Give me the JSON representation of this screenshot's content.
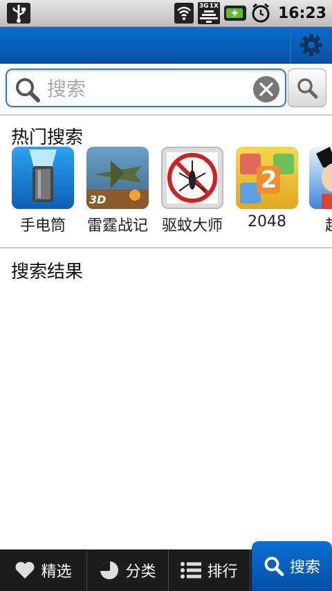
{
  "status_bar": {
    "time": "16:23",
    "net_labels": [
      "3G",
      "1X"
    ],
    "icons": [
      "usb-icon",
      "wifi-icon",
      "signal-icon",
      "battery-charging-icon",
      "alarm-icon"
    ]
  },
  "title_bar": {
    "settings_icon": "gear-icon"
  },
  "search": {
    "placeholder": "搜索",
    "value": ""
  },
  "hot_search": {
    "title": "热门搜索",
    "apps": [
      {
        "name": "手电筒",
        "icon": "flashlight-app-icon"
      },
      {
        "name": "雷霆战记",
        "icon": "fighter-plane-app-icon",
        "badge": "3D"
      },
      {
        "name": "驱蚊大师",
        "icon": "mosquito-app-icon"
      },
      {
        "name": "2048",
        "icon": "game-2048-app-icon",
        "badge": "2"
      },
      {
        "name": "超级",
        "icon": "cartoon-app-icon"
      }
    ]
  },
  "results": {
    "title": "搜索结果"
  },
  "tabs": [
    {
      "label": "精选",
      "icon": "heart-icon"
    },
    {
      "label": "分类",
      "icon": "pie-chart-icon"
    },
    {
      "label": "排行",
      "icon": "list-icon"
    },
    {
      "label": "搜索",
      "icon": "search-icon",
      "active": true
    }
  ],
  "colors": {
    "accent": "#0a6ccc",
    "tab_bg": "#1c1c1c"
  }
}
